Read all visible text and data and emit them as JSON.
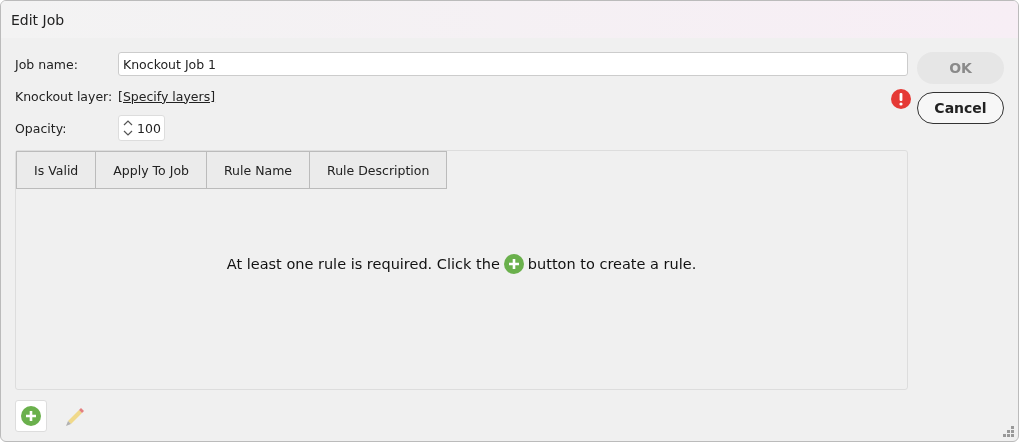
{
  "window": {
    "title": "Edit Job"
  },
  "form": {
    "job_name_label": "Job name:",
    "job_name_value": "Knockout Job 1",
    "layer_label": "Knockout layer:",
    "layer_link": "[Specify layers]",
    "opacity_label": "Opacity:",
    "opacity_value": "100"
  },
  "table": {
    "columns": [
      "Is Valid",
      "Apply To Job",
      "Rule Name",
      "Rule Description"
    ],
    "empty_before": "At least one rule is required. Click the",
    "empty_after": "button to create a rule."
  },
  "toolbar": [
    {
      "kind": "add",
      "disabled": false
    },
    {
      "kind": "edit",
      "disabled": true
    }
  ],
  "error": {
    "shown": true
  },
  "buttons": [
    {
      "label": "OK",
      "disabled": true
    },
    {
      "label": "Cancel",
      "disabled": false
    }
  ]
}
